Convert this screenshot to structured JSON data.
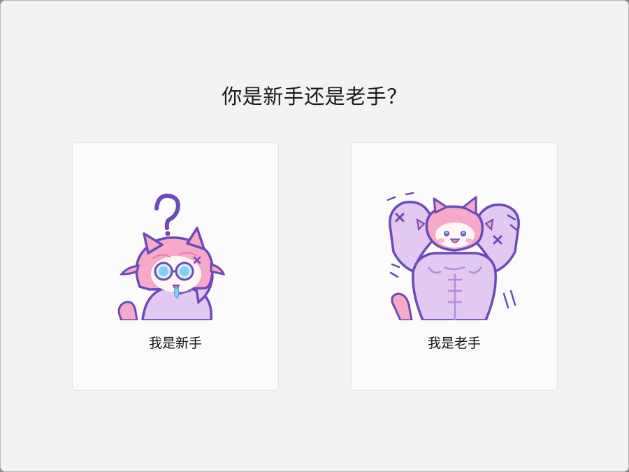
{
  "dialog": {
    "question": "你是新手还是老手？"
  },
  "options": [
    {
      "label": "我是新手",
      "illustration": "confused-catgirl-with-question-mark"
    },
    {
      "label": "我是老手",
      "illustration": "muscular-catgirl-flexing"
    }
  ],
  "colors": {
    "window_bg": "#f3f3f3",
    "card_bg": "#fbfbfb",
    "card_border": "#e4e4e4",
    "outline_purple": "#6a4bb8",
    "body_purple": "#e3c8f2",
    "hair_pink": "#f6a9c8",
    "glasses_blue": "#7fd0f2"
  }
}
